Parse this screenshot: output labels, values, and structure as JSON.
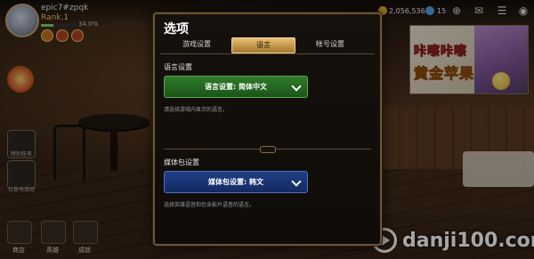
{
  "player": {
    "name": "epic7#zpqk",
    "rank": "Rank.1",
    "exp_text": "34.0%",
    "exp_fraction": 0.34
  },
  "currency": {
    "gold": "2,056,536",
    "crystal": "15"
  },
  "side_labels": {
    "event": "特别任务",
    "connect": "公告与活动"
  },
  "bottom_nav": {
    "shop": "商店",
    "hero": "英雄",
    "sanctuary": "成就"
  },
  "promo": {
    "line1": "咔嚓咔嚓",
    "line2": "黄金苹果"
  },
  "dialog": {
    "title": "选项",
    "tabs": [
      {
        "label": "游戏设置",
        "active": false
      },
      {
        "label": "语言",
        "active": true
      },
      {
        "label": "帐号设置",
        "active": false
      }
    ],
    "language": {
      "section_label": "语言设置",
      "button_label": "语言设置: 简体中文",
      "hint": "请选择游戏内显示的语言。"
    },
    "media": {
      "section_label": "媒体包设置",
      "button_label": "媒体包设置: 韩文",
      "hint": "选择英雄语音和包含影片语音的语言。"
    }
  },
  "watermark": {
    "text": "danji100.com"
  },
  "colors": {
    "accent_gold": "#e8bf72",
    "language_green": "#2f7c2a",
    "media_blue": "#213e86",
    "dialog_border": "#6f5432"
  }
}
